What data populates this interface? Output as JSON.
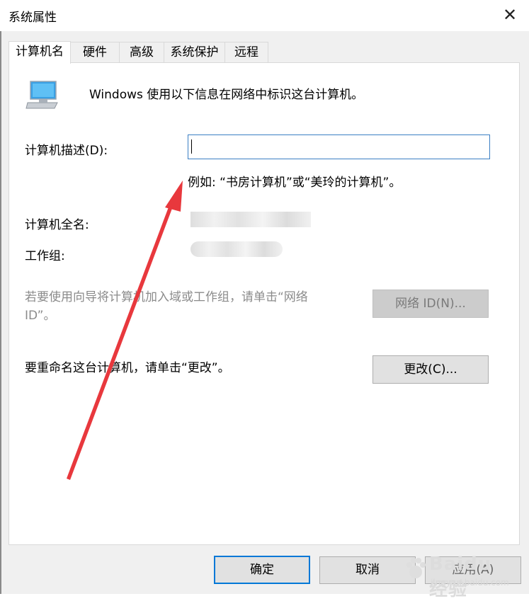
{
  "window": {
    "title": "系统属性"
  },
  "tabs": [
    {
      "label": "计算机名",
      "active": true
    },
    {
      "label": "硬件"
    },
    {
      "label": "高级"
    },
    {
      "label": "系统保护"
    },
    {
      "label": "远程"
    }
  ],
  "panel": {
    "intro": "Windows 使用以下信息在网络中标识这台计算机。",
    "description_label": "计算机描述(D):",
    "description_value": "",
    "example_text": "例如: “书房计算机”或“美玲的计算机”。",
    "fullname_label": "计算机全名:",
    "workgroup_label": "工作组:",
    "network_hint": "若要使用向导将计算机加入域或工作组，请单击“网络 ID”。",
    "network_button": "网络 ID(N)...",
    "rename_hint": "要重命名这台计算机，请单击“更改”。",
    "change_button": "更改(C)..."
  },
  "footer": {
    "ok": "确定",
    "cancel": "取消",
    "apply": "应用(A)"
  },
  "watermark": {
    "brand": "Baidu经验",
    "url": "jingyan.baidu.com"
  },
  "colors": {
    "arrow": "#e8383d",
    "focus_border": "#0078d7"
  }
}
